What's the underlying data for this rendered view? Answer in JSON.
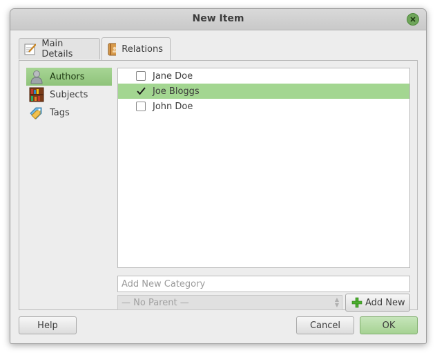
{
  "window": {
    "title": "New Item"
  },
  "tabs": [
    {
      "label": "Main Details",
      "icon": "edit-document-icon",
      "active": false
    },
    {
      "label": "Relations",
      "icon": "address-book-icon",
      "active": true
    }
  ],
  "sidebar": {
    "items": [
      {
        "label": "Authors",
        "icon": "person-icon",
        "selected": true
      },
      {
        "label": "Subjects",
        "icon": "bookshelf-icon",
        "selected": false
      },
      {
        "label": "Tags",
        "icon": "tag-icon",
        "selected": false
      }
    ]
  },
  "list": {
    "items": [
      {
        "label": "Jane Doe",
        "checked": false,
        "selected": false
      },
      {
        "label": "Joe Bloggs",
        "checked": true,
        "selected": true
      },
      {
        "label": "John Doe",
        "checked": false,
        "selected": false
      }
    ]
  },
  "category": {
    "placeholder": "Add New Category",
    "value": ""
  },
  "parent": {
    "value": "— No Parent —",
    "enabled": false
  },
  "add_new": {
    "label": "Add New",
    "icon": "plus-icon"
  },
  "buttons": {
    "help": "Help",
    "cancel": "Cancel",
    "ok": "OK"
  },
  "colors": {
    "accent_green": "#8fc37b",
    "selection_green": "#a3d691",
    "close_button": "#6fa55a"
  }
}
